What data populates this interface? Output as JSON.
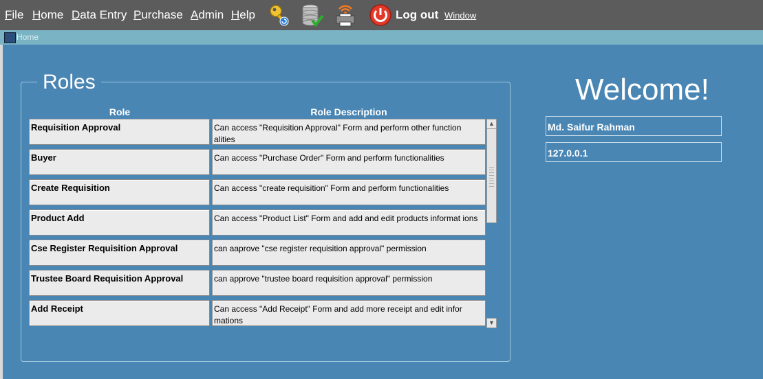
{
  "menu": [
    {
      "key": "file",
      "label": "File",
      "underline": "F",
      "rest": "ile"
    },
    {
      "key": "home",
      "label": "Home",
      "underline": "H",
      "rest": "ome"
    },
    {
      "key": "data_entry",
      "label": "Data Entry",
      "underline": "D",
      "rest": "ata Entry"
    },
    {
      "key": "purchase",
      "label": "Purchase",
      "underline": "P",
      "rest": "urchase"
    },
    {
      "key": "admin",
      "label": "Admin",
      "underline": "A",
      "rest": "dmin"
    },
    {
      "key": "help",
      "label": "Help",
      "underline": "H",
      "rest": "elp"
    }
  ],
  "toolbar": {
    "icons": [
      "key-icon",
      "database-check-icon",
      "printer-wireless-icon",
      "power-icon"
    ],
    "logout_label": "Log out",
    "window_label": "Window"
  },
  "tab": {
    "label": "Home"
  },
  "roles": {
    "title": "Roles",
    "col_role": "Role",
    "col_desc": "Role Description",
    "rows": [
      {
        "role": "Requisition Approval",
        "desc": "Can access \"Requisition Approval\" Form and perform other function alities"
      },
      {
        "role": "Buyer",
        "desc": "Can access \"Purchase Order\" Form and perform functionalities"
      },
      {
        "role": "Create Requisition",
        "desc": "Can access \"create requisition\" Form and perform functionalities"
      },
      {
        "role": "Product Add",
        "desc": "Can access \"Product List\" Form and add and edit products informat ions"
      },
      {
        "role": "Cse Register Requisition Approval",
        "desc": "can aaprove \"cse register requisition approval\" permission"
      },
      {
        "role": "Trustee Board Requisition Approval",
        "desc": "can approve \"trustee board requisition approval\" permission"
      },
      {
        "role": "Add Receipt",
        "desc": "Can access \"Add Receipt\" Form and add more receipt and edit infor mations"
      }
    ]
  },
  "welcome": {
    "title": "Welcome!",
    "user_name": "Md. Saifur Rahman",
    "ip_address": "127.0.0.1"
  },
  "colors": {
    "background": "#4a86b4",
    "menubar": "#5c5c5c",
    "tabbar": "#7ab3c4",
    "cell": "#ebebeb"
  }
}
